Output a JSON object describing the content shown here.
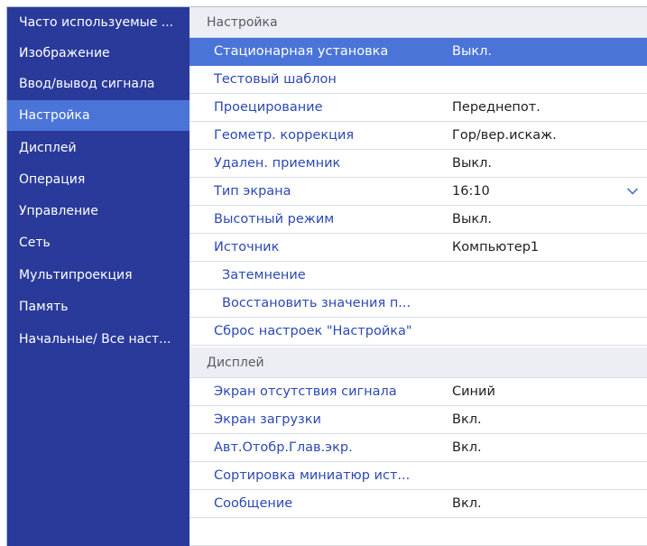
{
  "sidebar": {
    "items": [
      {
        "label": "Часто используемые ...",
        "active": false
      },
      {
        "label": "Изображение",
        "active": false
      },
      {
        "label": "Ввод/вывод сигнала",
        "active": false
      },
      {
        "label": "Настройка",
        "active": true
      },
      {
        "label": "Дисплей",
        "active": false
      },
      {
        "label": "Операция",
        "active": false
      },
      {
        "label": "Управление",
        "active": false
      },
      {
        "label": "Сеть",
        "active": false
      },
      {
        "label": "Мультипроекция",
        "active": false
      },
      {
        "label": "Память",
        "active": false
      },
      {
        "label": "Начальные/ Все наст...",
        "active": false
      }
    ]
  },
  "sections": [
    {
      "title": "Настройка",
      "rows": [
        {
          "label": "Стационарная установка",
          "value": "Выкл.",
          "selected": true
        },
        {
          "label": "Тестовый шаблон",
          "value": ""
        },
        {
          "label": "Проецирование",
          "value": "Переднепот."
        },
        {
          "label": "Геометр. коррекция",
          "value": "Гор/вер.искаж."
        },
        {
          "label": "Удален. приемник",
          "value": "Выкл."
        },
        {
          "label": "Тип экрана",
          "value": "16:10",
          "icon": "chevron-down-icon"
        },
        {
          "label": "Высотный режим",
          "value": "Выкл."
        },
        {
          "label": "Источник",
          "value": "Компьютер1"
        },
        {
          "label": "Затемнение",
          "value": "",
          "indent": true
        },
        {
          "label": "Восстановить значения п...",
          "value": "",
          "indent": true
        },
        {
          "label": "Сброс настроек \"Настройка\"",
          "value": ""
        }
      ]
    },
    {
      "title": "Дисплей",
      "rows": [
        {
          "label": "Экран отсутствия сигнала",
          "value": "Синий"
        },
        {
          "label": "Экран загрузки",
          "value": "Вкл."
        },
        {
          "label": "Авт.Отобр.Глав.экр.",
          "value": "Вкл."
        },
        {
          "label": "Сортировка миниатюр ист...",
          "value": ""
        },
        {
          "label": "Сообщение",
          "value": "Вкл."
        }
      ]
    }
  ],
  "colors": {
    "sidebar_bg": "#2a3a9a",
    "highlight": "#4a74d8",
    "label_text": "#2d49b3",
    "header_bg": "#eceef3"
  }
}
